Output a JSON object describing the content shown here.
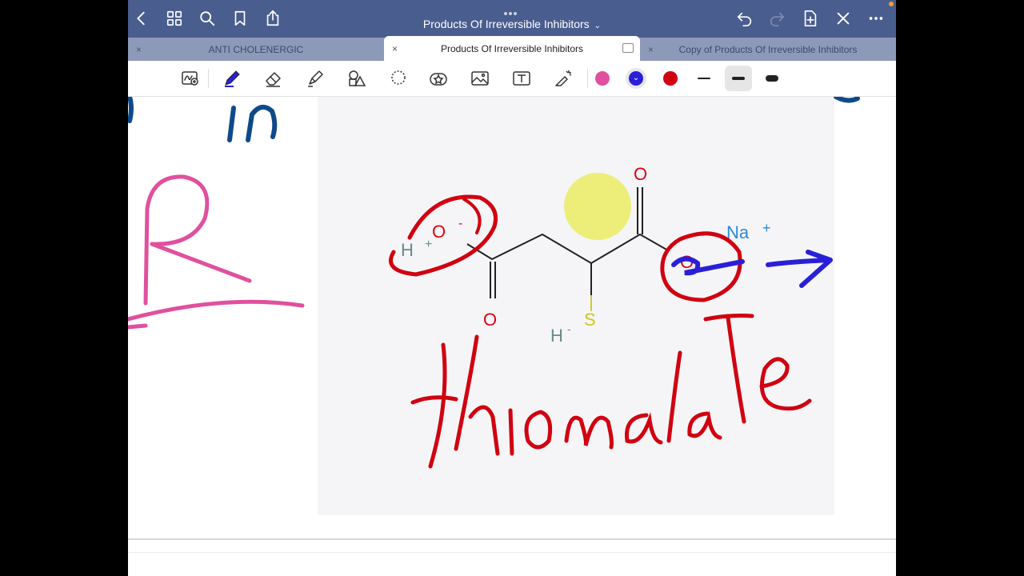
{
  "app": {
    "document_title": "Products Of Irreversible Inhibitors",
    "title_caret": "⌄"
  },
  "tabs": [
    {
      "label": "ANTI CHOLENERGIC",
      "active": false
    },
    {
      "label": "Products Of Irreversible Inhibitors",
      "active": true
    },
    {
      "label": "Copy of Products Of Irreversible Inhibitors",
      "active": false
    }
  ],
  "tab_close_glyph": "×",
  "colors": {
    "titlebar": "#4a5d8f",
    "pen_pink": "#e0509e",
    "pen_blue": "#2a1fd8",
    "pen_red": "#d00010",
    "ink_navy": "#0e4a8a"
  },
  "toolbar": {
    "tools": [
      "zoom-box-icon",
      "pen-icon",
      "eraser-icon",
      "highlighter-icon",
      "shapes-icon",
      "lasso-icon",
      "elements-icon",
      "image-icon",
      "text-icon",
      "laser-pointer-icon"
    ],
    "stroke_sizes": [
      "thin",
      "medium",
      "thick"
    ],
    "selected_stroke": "medium",
    "selected_color": "pen_blue"
  },
  "molecule": {
    "o_top": "O",
    "o_bottom": "O",
    "o_left": "O",
    "o_left_charge": "-",
    "h_plus": "H",
    "h_plus_charge": "+",
    "o_right": "O",
    "na": "Na",
    "na_charge": "+",
    "sulfur": "S",
    "h_minus": "H",
    "h_minus_charge": "-"
  },
  "handwriting": {
    "left_top": "in",
    "left_mid": "R",
    "main": "thiomalate"
  }
}
